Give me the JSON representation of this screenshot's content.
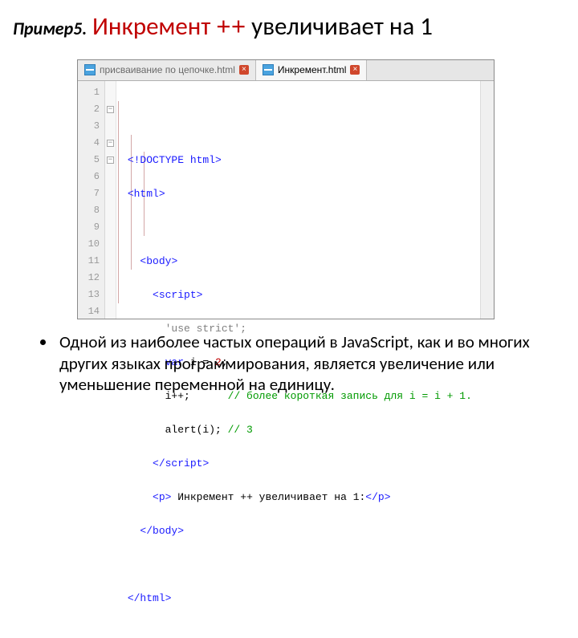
{
  "title": {
    "prefix": "Пример5.",
    "red_word": "Инкремент",
    "red_op": "++",
    "rest": "увеличивает на 1"
  },
  "tabs": {
    "inactive": {
      "label": "присваивание по цепочке.html"
    },
    "active": {
      "label": "Инкремент.html"
    }
  },
  "gutter": [
    "1",
    "2",
    "3",
    "4",
    "5",
    "6",
    "7",
    "8",
    "9",
    "10",
    "11",
    "12",
    "13",
    "14"
  ],
  "code": {
    "l1": "<!DOCTYPE html>",
    "l2a": "<",
    "l2b": "html",
    "l2c": ">",
    "l4a": "<",
    "l4b": "body",
    "l4c": ">",
    "l5a": "<",
    "l5b": "script",
    "l5c": ">",
    "l6": "'use strict';",
    "l7a": "var",
    "l7b": " i = ",
    "l7c": "2",
    "l7d": ";",
    "l8a": "i++;",
    "l8b": "// более короткая запись для i = i + 1.",
    "l9a": "alert(i); ",
    "l9b": "// 3",
    "l10a": "</",
    "l10b": "script",
    "l10c": ">",
    "l11a": "<",
    "l11b": "p",
    "l11c": ">",
    "l11d": " Инкремент ++ увеличивает на 1:",
    "l11e": "</",
    "l11f": "p",
    "l11g": ">",
    "l12a": "</",
    "l12b": "body",
    "l12c": ">",
    "l14a": "</",
    "l14b": "html",
    "l14c": ">"
  },
  "bullet": "Одной из наиболее частых операций в JavaScript, как и во многих других языках программирования, является увеличение или уменьшение переменной на единицу."
}
